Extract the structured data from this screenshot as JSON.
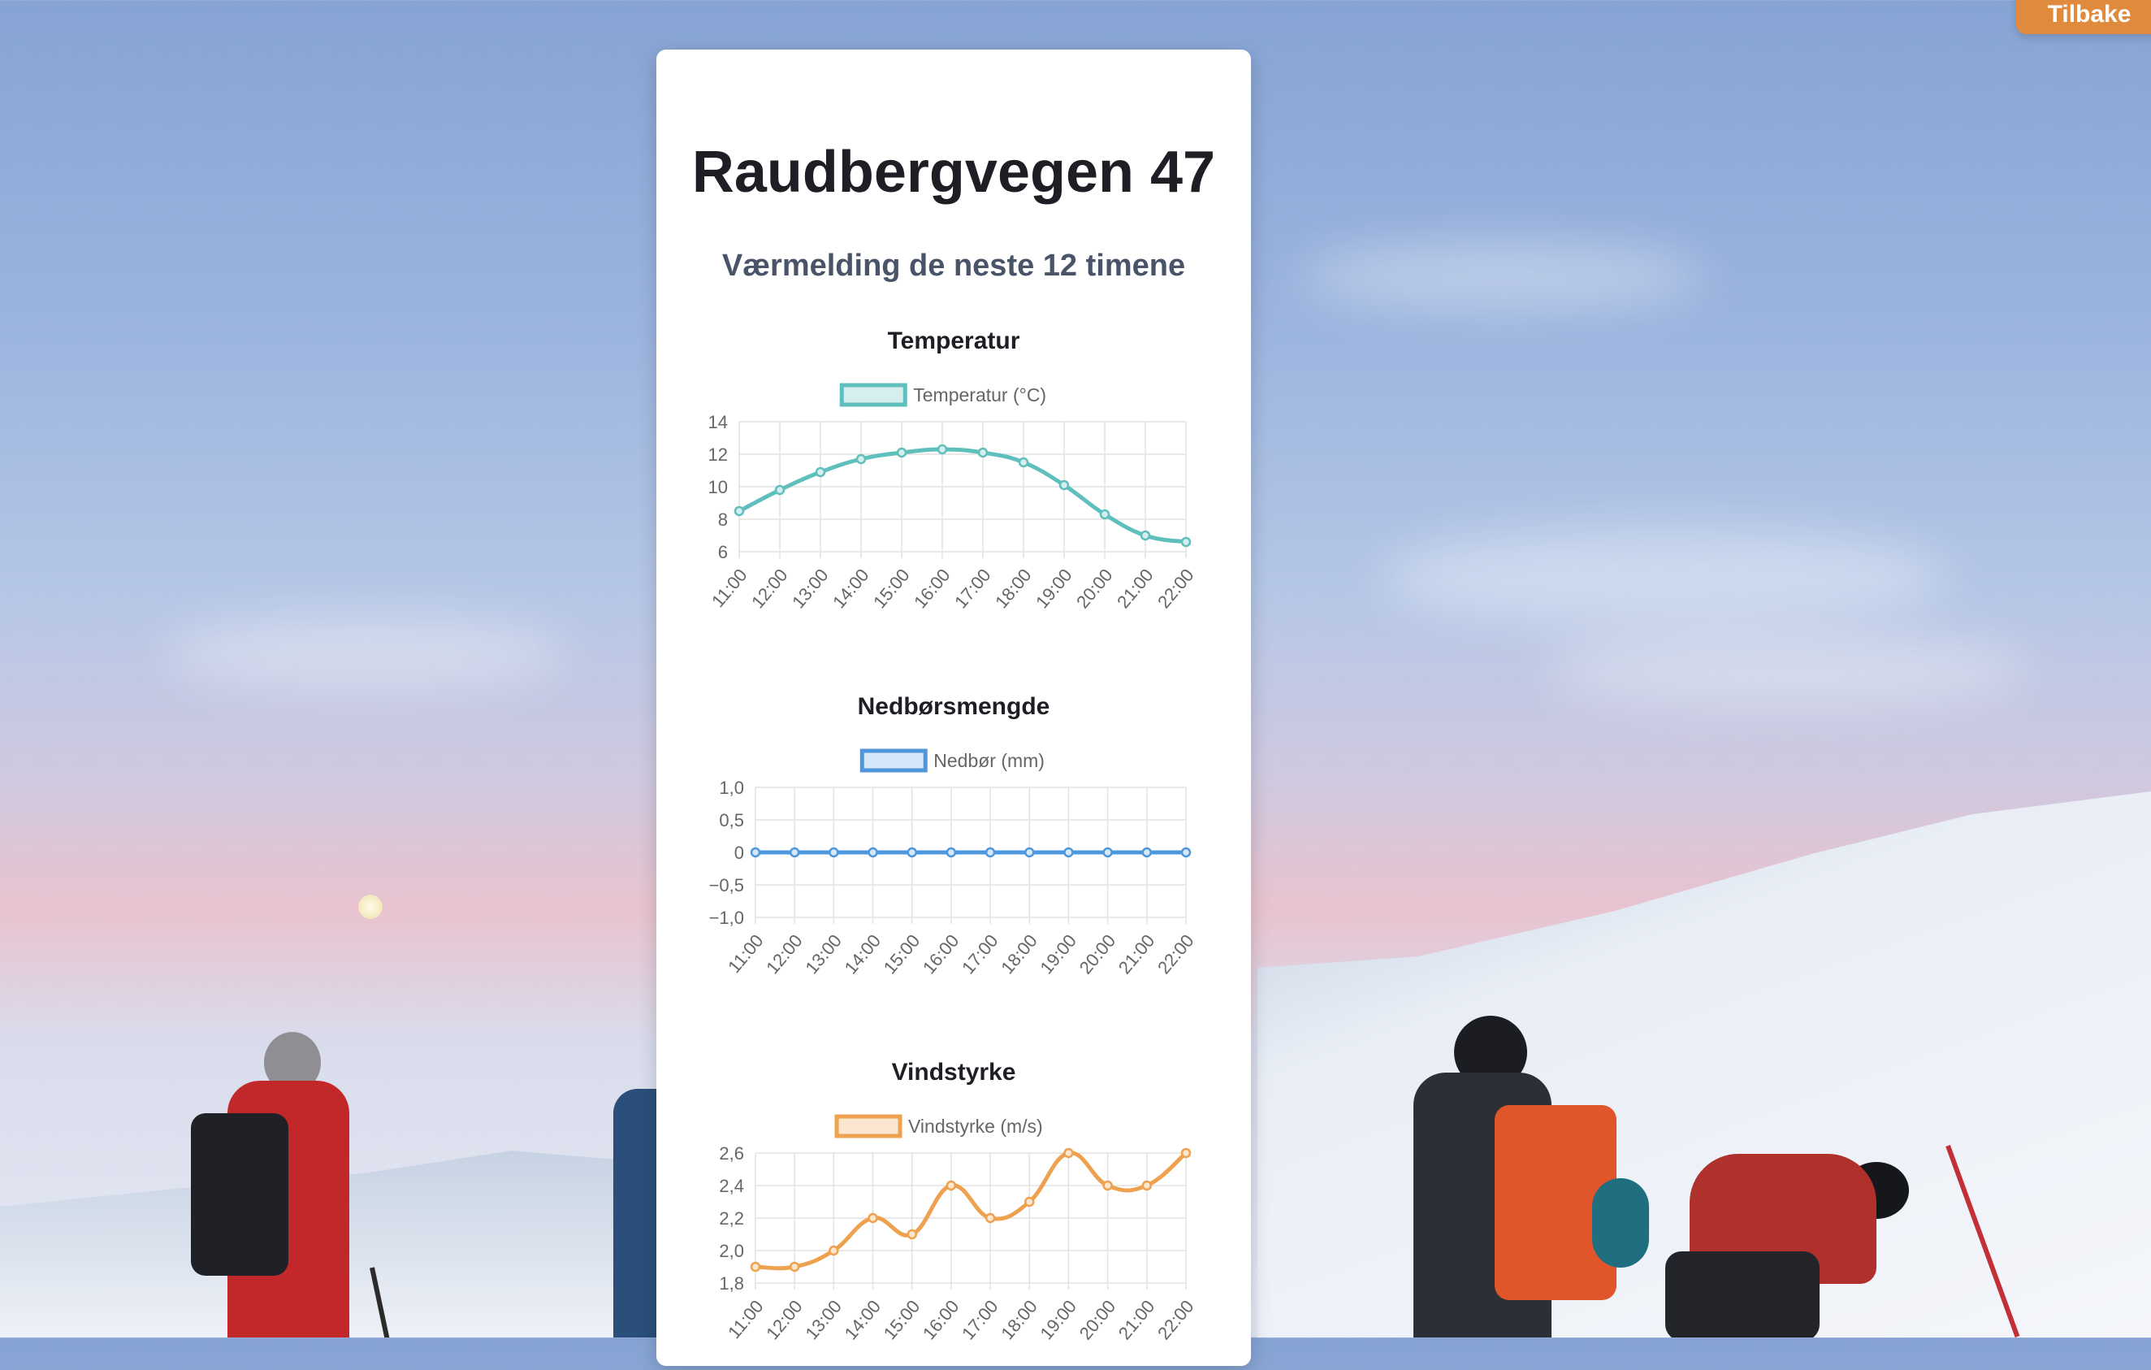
{
  "page": {
    "title": "Raudbergvegen 47",
    "subtitle": "Værmelding de neste 12 timene",
    "back_label": "Tilbake"
  },
  "chart_data": [
    {
      "type": "line",
      "title": "Temperatur",
      "x": [
        "11:00",
        "12:00",
        "13:00",
        "14:00",
        "15:00",
        "16:00",
        "17:00",
        "18:00",
        "19:00",
        "20:00",
        "21:00",
        "22:00"
      ],
      "series": [
        {
          "name": "Temperatur (°C)",
          "values": [
            8.5,
            9.8,
            10.9,
            11.7,
            12.1,
            12.3,
            12.1,
            11.5,
            10.1,
            8.3,
            7.0,
            6.6
          ]
        }
      ],
      "ylim": [
        6,
        14
      ],
      "yticks": [
        "14",
        "12",
        "10",
        "8",
        "6"
      ],
      "ytick_values": [
        14,
        12,
        10,
        8,
        6
      ],
      "grid": true,
      "legend": "top",
      "color": "#5fbfbd",
      "fill": "#d6efee"
    },
    {
      "type": "line",
      "title": "Nedbørsmengde",
      "x": [
        "11:00",
        "12:00",
        "13:00",
        "14:00",
        "15:00",
        "16:00",
        "17:00",
        "18:00",
        "19:00",
        "20:00",
        "21:00",
        "22:00"
      ],
      "series": [
        {
          "name": "Nedbør (mm)",
          "values": [
            0,
            0,
            0,
            0,
            0,
            0,
            0,
            0,
            0,
            0,
            0,
            0
          ]
        }
      ],
      "ylim": [
        -1.0,
        1.0
      ],
      "yticks": [
        "1,0",
        "0,5",
        "0",
        "−0,5",
        "−1,0"
      ],
      "ytick_values": [
        1.0,
        0.5,
        0,
        -0.5,
        -1.0
      ],
      "grid": true,
      "legend": "top",
      "color": "#4d97dc",
      "fill": "#d5e7f8"
    },
    {
      "type": "line",
      "title": "Vindstyrke",
      "x": [
        "11:00",
        "12:00",
        "13:00",
        "14:00",
        "15:00",
        "16:00",
        "17:00",
        "18:00",
        "19:00",
        "20:00",
        "21:00",
        "22:00"
      ],
      "series": [
        {
          "name": "Vindstyrke (m/s)",
          "values": [
            1.9,
            1.9,
            2.0,
            2.2,
            2.1,
            2.4,
            2.2,
            2.3,
            2.6,
            2.4,
            2.4,
            2.6
          ]
        }
      ],
      "ylim": [
        1.8,
        2.6
      ],
      "yticks": [
        "2,6",
        "2,4",
        "2,2",
        "2,0",
        "1,8"
      ],
      "ytick_values": [
        2.6,
        2.4,
        2.2,
        2.0,
        1.8
      ],
      "grid": true,
      "legend": "top",
      "color": "#eea14f",
      "fill": "#fbe6cf"
    }
  ]
}
